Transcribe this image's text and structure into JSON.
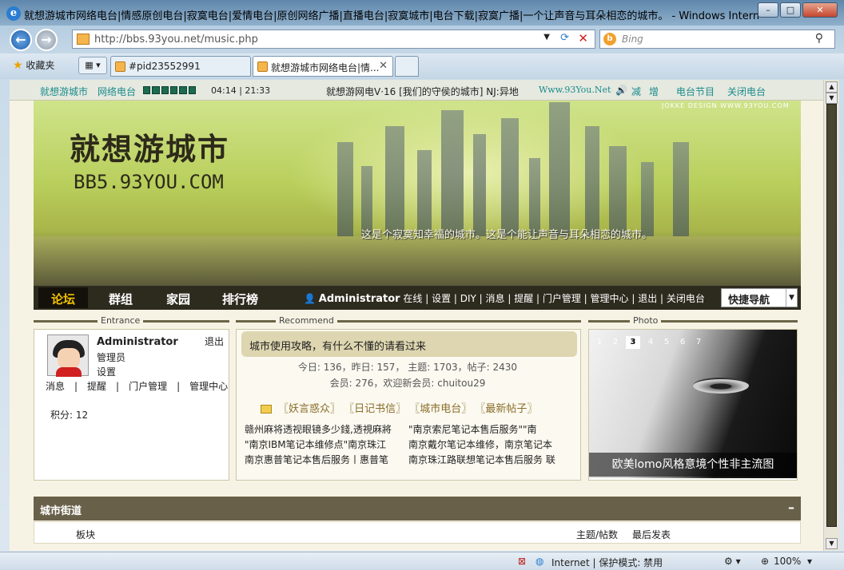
{
  "window": {
    "title": "就想游城市网络电台|情感原创电台|寂寞电台|爱情电台|原创网络广播|直播电台|寂寞城市|电台下载|寂寞广播|一个让声音与耳朵相恋的城市。 - Windows Internet Explorer",
    "min": "–",
    "max": "□",
    "close": "✕"
  },
  "browser": {
    "url": "http://bbs.93you.net/music.php",
    "search_placeholder": "Bing",
    "favorites_label": "收藏夹",
    "tabs": [
      {
        "label": "#pid23552991"
      },
      {
        "label": "就想游城市网络电台|情..."
      }
    ]
  },
  "radio": {
    "title1": "就想游城市",
    "title2": "网络电台",
    "time": "04:14 | 21:33",
    "now_playing": "就想游网电V·16 [我们的守侯的城市] NJ:异地",
    "site": "Www.93You.Net",
    "vol_label": "减",
    "vol_up": "增",
    "schedule": "电台节目",
    "close_radio": "关闭电台"
  },
  "banner": {
    "logo": "就想游城市",
    "logo_url": "BB5.93YOU.COM",
    "tagline": "这是个寂寞知幸福的城市。这是个能让声音与耳朵相恋的城市。",
    "credit": "JOKKE DESIGN    WWW.93YOU.COM"
  },
  "nav": {
    "items": [
      "论坛",
      "群组",
      "家园",
      "排行榜"
    ],
    "user": "Administrator",
    "user_links": "在线 | 设置 | DIY | 消息 | 提醒 | 门户管理 | 管理中心 | 退出 | 关闭电台",
    "quick_nav": "快捷导航"
  },
  "entrance": {
    "heading": "Entrance",
    "name": "Administrator",
    "logout": "退出",
    "role": "管理员",
    "settings": "设置",
    "links": "消息　|　提醒　|　门户管理　|　管理中心",
    "points": "积分: 12"
  },
  "recommend": {
    "heading": "Recommend",
    "tip": "城市使用攻略，有什么不懂的请看过来",
    "stats1": "今日: 136，昨日: 157，  主题: 1703，帖子: 2430",
    "stats2": "会员: 276，欢迎新会员: chuitou29",
    "cats": "〖妖言惑众〗 〖日记书信〗 〖城市电台〗 〖最新帖子〗",
    "left_list": [
      "赣州麻将透视眼镜多少錢,透視麻將",
      "\"南京IBM笔记本维修点\"南京珠江",
      "南京惠普笔记本售后服务丨惠普笔"
    ],
    "right_list": [
      "\"南京索尼笔记本售后服务\"\"南",
      "南京戴尔笔记本维修，南京笔记本",
      "南京珠江路联想笔记本售后服务 联"
    ]
  },
  "photo": {
    "heading": "Photo",
    "pages": [
      "1",
      "2",
      "3",
      "4",
      "5",
      "6",
      "7"
    ],
    "caption": "欧美lomo风格意境个性非主流图"
  },
  "forum": {
    "section": "城市街道",
    "minimize": "–",
    "col_board": "板块",
    "col_count": "主题/帖数",
    "col_last": "最后发表"
  },
  "statusbar": {
    "zone": "Internet | 保护模式: 禁用",
    "zoom": "100%"
  }
}
